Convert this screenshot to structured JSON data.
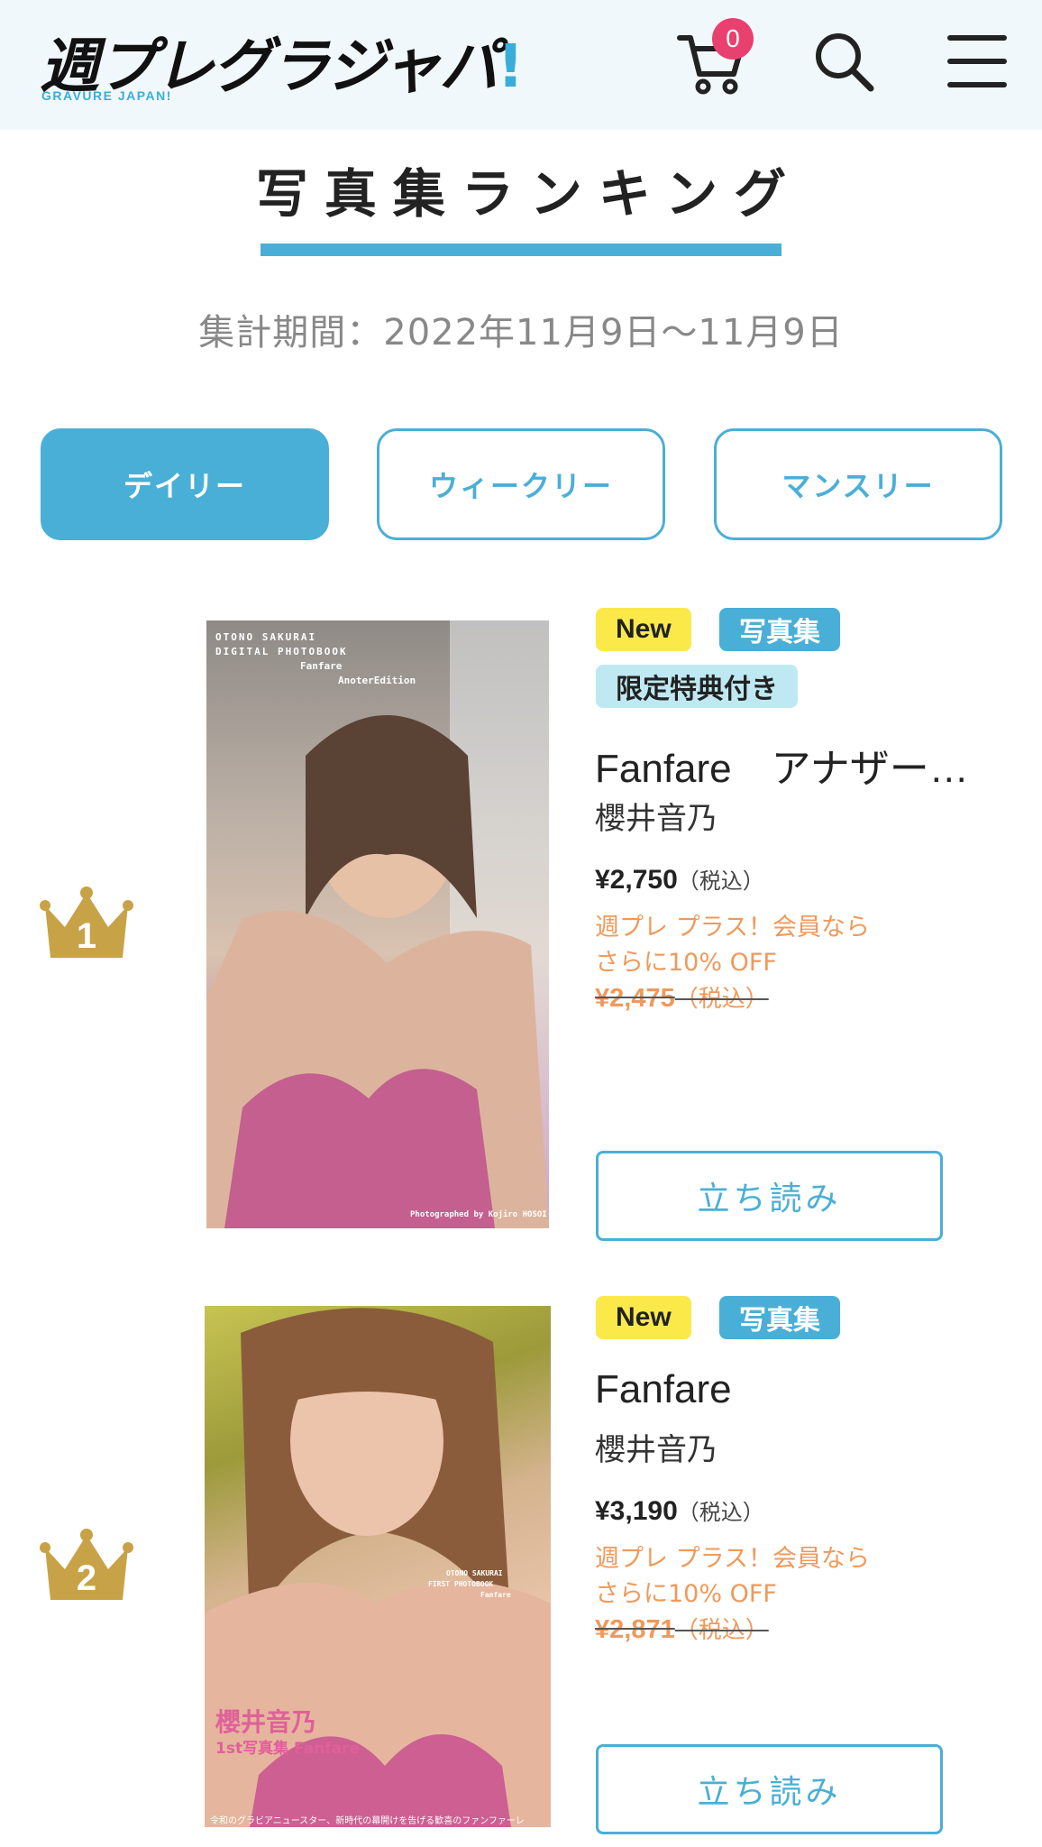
{
  "header": {
    "logo_text": "週プレグラジャパ",
    "logo_mark": "!",
    "logo_sub": "GRAVURE JAPAN!",
    "cart_count": "0",
    "cart_icon": "cart-icon",
    "search_icon": "search-icon",
    "menu_icon": "hamburger-menu-icon"
  },
  "page": {
    "title": "写真集ランキング",
    "period": "集計期間：2022年11月9日〜11月9日"
  },
  "tabs": [
    {
      "label": "デイリー",
      "active": true
    },
    {
      "label": "ウィークリー",
      "active": false
    },
    {
      "label": "マンスリー",
      "active": false
    }
  ],
  "colors": {
    "accent": "#4aafd6",
    "new_badge": "#fbe94a",
    "bonus_badge": "#bfe9f2",
    "member_price": "#f0995a",
    "crown": "#c8a246",
    "cart_badge": "#e8416f"
  },
  "items": [
    {
      "rank": "1",
      "badges": [
        "New",
        "写真集",
        "限定特典付き"
      ],
      "title": "Fanfare　アナザー…",
      "author": "櫻井音乃",
      "price": "¥2,750",
      "tax": "（税込）",
      "member_line1": "週プレ プラス！会員なら",
      "member_line2": "さらに10% OFF",
      "member_price": "¥2,475",
      "member_tax": "（税込）",
      "read_button": "立ち読み",
      "cover_lines": [
        "OTONO SAKURAI",
        "DIGITAL PHOTOBOOK",
        "Fanfare",
        "AnoterEdition",
        "Photographed by Kojiro HOSOI"
      ]
    },
    {
      "rank": "2",
      "badges": [
        "New",
        "写真集"
      ],
      "title": "Fanfare",
      "author": "櫻井音乃",
      "price": "¥3,190",
      "tax": "（税込）",
      "member_line1": "週プレ プラス！会員なら",
      "member_line2": "さらに10% OFF",
      "member_price": "¥2,871",
      "member_tax": "（税込）",
      "read_button": "立ち読み",
      "cover_lines": [
        "OTONO SAKURAI",
        "FIRST PHOTOBOOK",
        "Fanfare",
        "櫻井音乃",
        "1st写真集 Fanfare",
        "令和のグラビアニュースター、新時代の幕開けを告げる歓喜のファンファーレ"
      ]
    }
  ]
}
